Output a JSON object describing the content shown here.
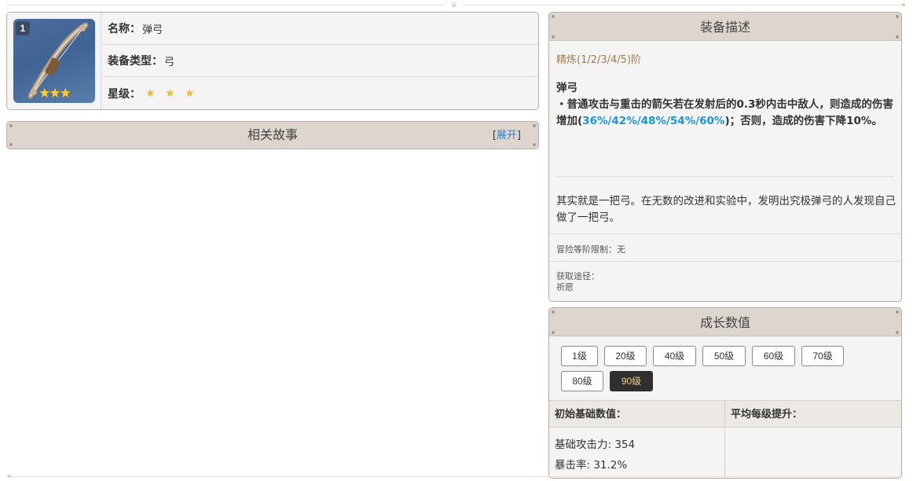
{
  "info": {
    "badge": "1",
    "thumb_stars": "★★★",
    "rows": [
      {
        "label": "名称：",
        "value": "弹弓"
      },
      {
        "label": "装备类型：",
        "value": "弓"
      },
      {
        "label": "星级：",
        "value": "★ ★ ★"
      }
    ]
  },
  "story": {
    "title": "相关故事",
    "expand_open": "[",
    "expand_label": "展开",
    "expand_close": "]"
  },
  "desc": {
    "title": "装备描述",
    "refine": "精炼(1/2/3/4/5)阶",
    "passive_name": "弹弓",
    "passive_text_1": "・普通攻击与重击的箭矢若在发射后的0.3秒内击中敌人，则造成的伤害增加(",
    "passive_values": "36%/42%/48%/54%/60%",
    "passive_text_2": ")；否则，造成的伤害下降10%。",
    "lore": "其实就是一把弓。在无数的改进和实验中，发明出究极弹弓的人发现自己做了一把弓。",
    "level_limit": "冒险等阶限制：无",
    "obtain_label": "获取途径：",
    "obtain_value": "祈愿"
  },
  "growth": {
    "title": "成长数值",
    "levels": [
      "1级",
      "20级",
      "40级",
      "50级",
      "60级",
      "70级",
      "80级",
      "90级"
    ],
    "active_level": "90级",
    "base_header": "初始基础数值：",
    "avg_header": "平均每级提升：",
    "stats": [
      "基础攻击力: 354",
      "暴击率: 31.2%"
    ]
  },
  "colors": {
    "accent_gold": "#a37c4c",
    "highlight_blue": "#1e96d4",
    "header_bg": "#ddd6cf",
    "active_button_text": "#f1cf8e"
  }
}
